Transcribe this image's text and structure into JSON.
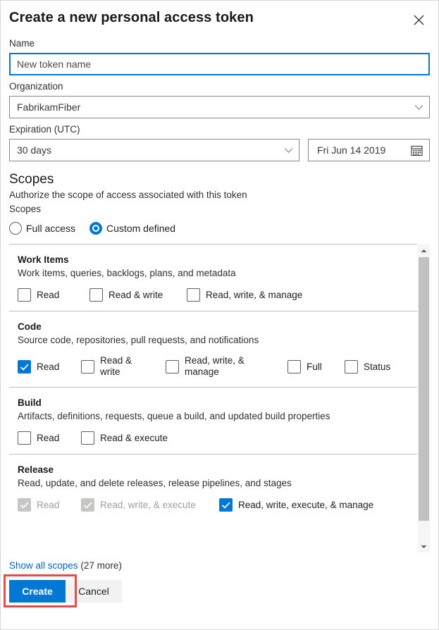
{
  "dialog": {
    "title": "Create a new personal access token",
    "close_icon": "close-icon"
  },
  "name_field": {
    "label": "Name",
    "value": "New token name",
    "placeholder": "New token name"
  },
  "organization_field": {
    "label": "Organization",
    "value": "FabrikamFiber",
    "chevron_icon": "chevron-down-icon"
  },
  "expiration_field": {
    "label": "Expiration (UTC)",
    "duration_value": "30 days",
    "date_value": "Fri Jun 14 2019",
    "chevron_icon": "chevron-down-icon",
    "calendar_icon": "calendar-icon"
  },
  "scopes": {
    "heading": "Scopes",
    "subtitle": "Authorize the scope of access associated with this token",
    "group_label": "Scopes",
    "options": [
      {
        "label": "Full access",
        "checked": false
      },
      {
        "label": "Custom defined",
        "checked": true
      }
    ],
    "groups": [
      {
        "title": "Work Items",
        "description": "Work items, queries, backlogs, plans, and metadata",
        "checkboxes": [
          {
            "label": "Read",
            "checked": false,
            "disabled": false
          },
          {
            "label": "Read & write",
            "checked": false,
            "disabled": false
          },
          {
            "label": "Read, write, & manage",
            "checked": false,
            "disabled": false
          }
        ]
      },
      {
        "title": "Code",
        "description": "Source code, repositories, pull requests, and notifications",
        "checkboxes": [
          {
            "label": "Read",
            "checked": true,
            "disabled": false
          },
          {
            "label": "Read & write",
            "checked": false,
            "disabled": false
          },
          {
            "label": "Read, write, & manage",
            "checked": false,
            "disabled": false
          },
          {
            "label": "Full",
            "checked": false,
            "disabled": false
          },
          {
            "label": "Status",
            "checked": false,
            "disabled": false
          }
        ]
      },
      {
        "title": "Build",
        "description": "Artifacts, definitions, requests, queue a build, and updated build properties",
        "checkboxes": [
          {
            "label": "Read",
            "checked": false,
            "disabled": false
          },
          {
            "label": "Read & execute",
            "checked": false,
            "disabled": false
          }
        ]
      },
      {
        "title": "Release",
        "description": "Read, update, and delete releases, release pipelines, and stages",
        "checkboxes": [
          {
            "label": "Read",
            "checked": true,
            "disabled": true
          },
          {
            "label": "Read, write, & execute",
            "checked": true,
            "disabled": true
          },
          {
            "label": "Read, write, execute, & manage",
            "checked": true,
            "disabled": false
          }
        ]
      }
    ],
    "scrollbar": {
      "up_icon": "scroll-up-arrow-icon",
      "down_icon": "scroll-down-arrow-icon"
    }
  },
  "show_all": {
    "link": "Show all scopes",
    "count": "(27 more)"
  },
  "footer": {
    "create_label": "Create",
    "cancel_label": "Cancel"
  },
  "colors": {
    "accent": "#0078d4",
    "link": "#0067b8",
    "highlight": "#e74c4c",
    "disabled": "#c8c6c4"
  }
}
